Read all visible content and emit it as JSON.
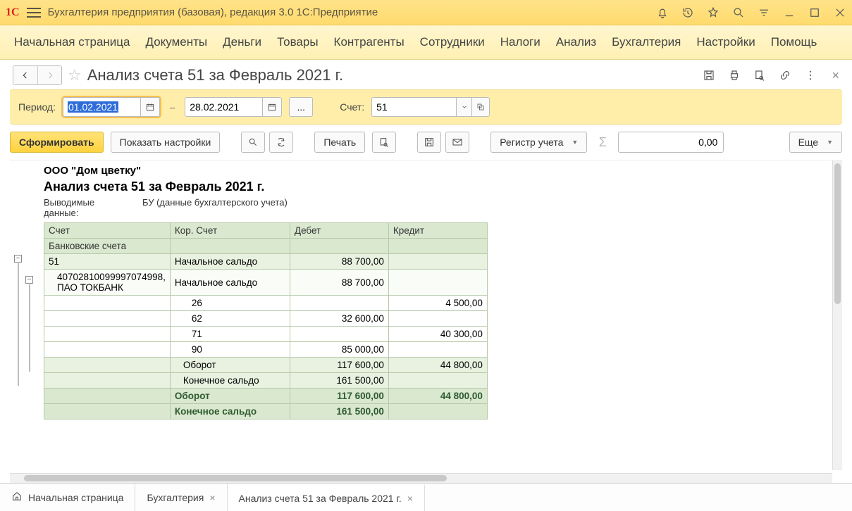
{
  "app": {
    "title": "Бухгалтерия предприятия (базовая), редакция 3.0 1С:Предприятие"
  },
  "menu": {
    "items": [
      "Начальная страница",
      "Документы",
      "Деньги",
      "Товары",
      "Контрагенты",
      "Сотрудники",
      "Налоги",
      "Анализ",
      "Бухгалтерия",
      "Настройки",
      "Помощь"
    ]
  },
  "page": {
    "title": "Анализ счета 51 за Февраль 2021 г."
  },
  "filter": {
    "period_label": "Период:",
    "date_from": "01.02.2021",
    "date_to": "28.02.2021",
    "dots": "...",
    "account_label": "Счет:",
    "account_value": "51"
  },
  "toolbar": {
    "generate": "Сформировать",
    "show_settings": "Показать настройки",
    "print": "Печать",
    "register": "Регистр учета",
    "amount": "0,00",
    "more": "Еще"
  },
  "report": {
    "org": "ООО \"Дом цветку\"",
    "title": "Анализ счета 51 за Февраль 2021 г.",
    "meta_label": "Выводимые данные:",
    "meta_value": "БУ (данные бухгалтерского учета)",
    "headers": {
      "acct": "Счет",
      "cor": "Кор. Счет",
      "debit": "Дебет",
      "credit": "Кредит"
    },
    "bank_accounts": "Банковские счета",
    "rows": [
      {
        "a": "51",
        "c": "Начальное сальдо",
        "d": "88 700,00",
        "k": "",
        "cls": "lvl1"
      },
      {
        "a": "40702810099997074998, ПАО ТОКБАНК",
        "c": "Начальное сальдо",
        "d": "88 700,00",
        "k": "",
        "cls": "lvl2",
        "ind": "indent1"
      },
      {
        "a": "",
        "c": "26",
        "d": "",
        "k": "4 500,00",
        "cls": "",
        "cind": "indent2"
      },
      {
        "a": "",
        "c": "62",
        "d": "32 600,00",
        "k": "",
        "cls": "",
        "cind": "indent2"
      },
      {
        "a": "",
        "c": "71",
        "d": "",
        "k": "40 300,00",
        "cls": "",
        "cind": "indent2"
      },
      {
        "a": "",
        "c": "90",
        "d": "85 000,00",
        "k": "",
        "cls": "",
        "cind": "indent2"
      },
      {
        "a": "",
        "c": "Оборот",
        "d": "117 600,00",
        "k": "44 800,00",
        "cls": "lvl1",
        "cind": "indent1"
      },
      {
        "a": "",
        "c": "Конечное сальдо",
        "d": "161 500,00",
        "k": "",
        "cls": "lvl1",
        "cind": "indent1"
      },
      {
        "a": "",
        "c": "Оборот",
        "d": "117 600,00",
        "k": "44 800,00",
        "cls": "grand"
      },
      {
        "a": "",
        "c": "Конечное сальдо",
        "d": "161 500,00",
        "k": "",
        "cls": "grand"
      }
    ]
  },
  "tabs": {
    "home": "Начальная страница",
    "t1": "Бухгалтерия",
    "t2": "Анализ счета 51 за Февраль 2021 г."
  }
}
